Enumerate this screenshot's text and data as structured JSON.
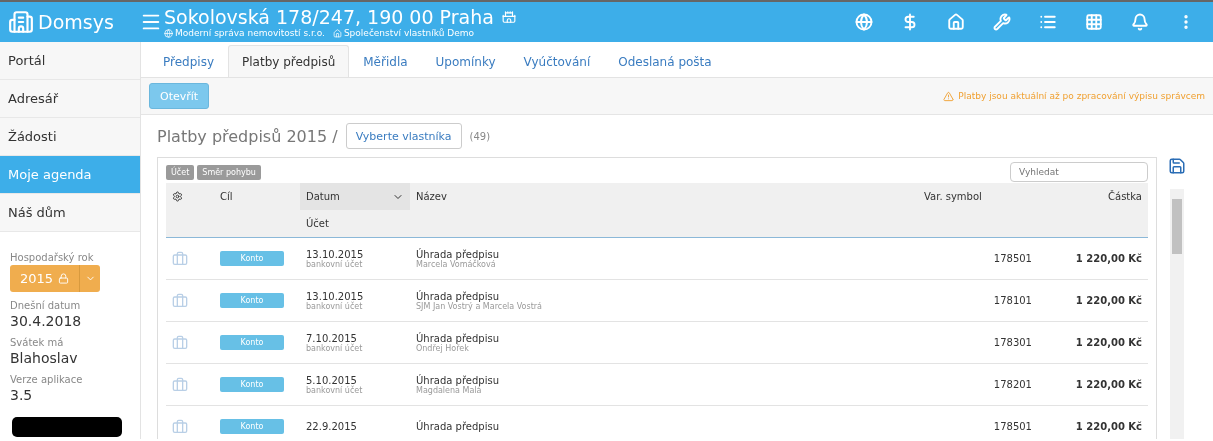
{
  "header": {
    "logo": "Domsys",
    "title": "Sokolovská 178/247, 190 00 Praha",
    "company": "Moderní správa nemovitostí s.r.o.",
    "association": "Společenství vlastníků Demo"
  },
  "sidebar": {
    "items": [
      {
        "label": "Portál",
        "selected": false
      },
      {
        "label": "Adresář",
        "selected": false
      },
      {
        "label": "Žádosti",
        "selected": false
      },
      {
        "label": "Moje agenda",
        "selected": true
      },
      {
        "label": "Náš dům",
        "selected": false
      }
    ],
    "info": [
      {
        "label": "Hospodařský rok",
        "kind": "year",
        "value": "2015"
      },
      {
        "label": "Dnešní datum",
        "kind": "text",
        "value": "30.4.2018"
      },
      {
        "label": "Svátek má",
        "kind": "text",
        "value": "Blahoslav"
      },
      {
        "label": "Verze aplikace",
        "kind": "text",
        "value": "3.5"
      }
    ]
  },
  "tabs": [
    {
      "label": "Předpisy",
      "selected": false
    },
    {
      "label": "Platby předpisů",
      "selected": true
    },
    {
      "label": "Měřidla",
      "selected": false
    },
    {
      "label": "Upomínky",
      "selected": false
    },
    {
      "label": "Vyúčtování",
      "selected": false
    },
    {
      "label": "Odeslaná pošta",
      "selected": false
    }
  ],
  "toolbar": {
    "button": "Otevřít",
    "warning": "Platby jsou aktuální až po zpracování výpisu správcem"
  },
  "page": {
    "title": "Platby předpisů 2015 /",
    "owner_button": "Vyberte vlastníka",
    "count": "(49)"
  },
  "filters": [
    "Účet",
    "Směr pohybu"
  ],
  "search": {
    "placeholder": "Vyhledat"
  },
  "table": {
    "columns": {
      "target": "Cíl",
      "date": "Datum",
      "account": "Účet",
      "name": "Název",
      "symbol": "Var. symbol",
      "amount": "Částka"
    },
    "rows": [
      {
        "target": "Konto",
        "date": "13.10.2015",
        "account": "bankovní účet",
        "name": "Úhrada předpisu",
        "person": "Marcela Vomáčková",
        "symbol": "178501",
        "amount": "1 220,00 Kč"
      },
      {
        "target": "Konto",
        "date": "13.10.2015",
        "account": "bankovní účet",
        "name": "Úhrada předpisu",
        "person": "SJM Jan Vostrý a Marcela Vostrá",
        "symbol": "178101",
        "amount": "1 220,00 Kč"
      },
      {
        "target": "Konto",
        "date": "7.10.2015",
        "account": "bankovní účet",
        "name": "Úhrada předpisu",
        "person": "Ondřej Hořek",
        "symbol": "178301",
        "amount": "1 220,00 Kč"
      },
      {
        "target": "Konto",
        "date": "5.10.2015",
        "account": "bankovní účet",
        "name": "Úhrada předpisu",
        "person": "Magdalena Malá",
        "symbol": "178201",
        "amount": "1 220,00 Kč"
      },
      {
        "target": "Konto",
        "date": "22.9.2015",
        "name": "Úhrada předpisu",
        "symbol": "178501",
        "amount": "1 220,00 Kč"
      }
    ]
  }
}
